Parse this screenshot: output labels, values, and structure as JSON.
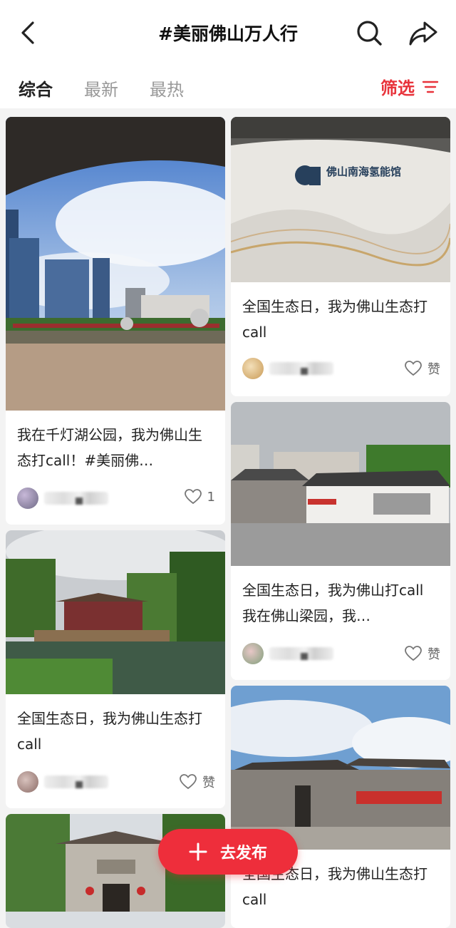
{
  "header": {
    "title": "#美丽佛山万人行"
  },
  "tabs": [
    {
      "label": "综合",
      "active": true
    },
    {
      "label": "最新",
      "active": false
    },
    {
      "label": "最热",
      "active": false
    }
  ],
  "filter": {
    "label": "筛选"
  },
  "cards": [
    {
      "title": "我在千灯湖公园，我为佛山生态打call！#美丽佛…",
      "like_count": "1",
      "image_sign": ""
    },
    {
      "title": "全国生态日，我为佛山生态打call",
      "like_count": "赞",
      "image_sign": "佛山南海氢能馆"
    },
    {
      "title": "全国生态日，我为佛山生态打call",
      "like_count": "赞",
      "image_sign": ""
    },
    {
      "title": "全国生态日，我为佛山打call 我在佛山梁园，我…",
      "like_count": "赞",
      "image_sign": ""
    },
    {
      "title": "全国生态日，我为佛山生态打call",
      "like_count": "",
      "image_sign": ""
    }
  ],
  "fab": {
    "label": "去发布"
  },
  "colors": {
    "accent": "#ee2e3b"
  }
}
